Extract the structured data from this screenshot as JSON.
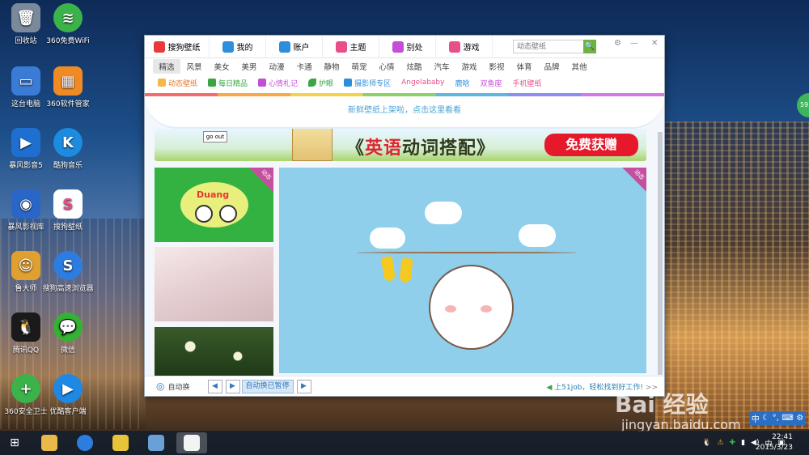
{
  "desktop": {
    "icons": [
      {
        "label": "回收站",
        "icon": "recycle-bin-icon",
        "color": "#7a8a9a",
        "glyph": "🗑"
      },
      {
        "label": "360免费WiFi",
        "icon": "wifi-icon",
        "color": "#3bb34a",
        "glyph": "≋"
      },
      {
        "label": "这台电脑",
        "icon": "computer-icon",
        "color": "#3a7bd5",
        "glyph": "▭"
      },
      {
        "label": "360软件管家",
        "icon": "app-store-icon",
        "color": "#f08a24",
        "glyph": "▦"
      },
      {
        "label": "暴风影音5",
        "icon": "media-player-icon",
        "color": "#1f6fd0",
        "glyph": "▶"
      },
      {
        "label": "酷狗音乐",
        "icon": "music-icon",
        "color": "#1d8be0",
        "glyph": "K"
      },
      {
        "label": "暴风影视库",
        "icon": "video-library-icon",
        "color": "#2a66c7",
        "glyph": "◉"
      },
      {
        "label": "搜狗壁纸",
        "icon": "wallpaper-app-icon",
        "color": "#ffffff",
        "glyph": "S"
      },
      {
        "label": "鲁大师",
        "icon": "ludashi-icon",
        "color": "#e0a030",
        "glyph": "☺"
      },
      {
        "label": "搜狗高速浏览器",
        "icon": "browser-icon",
        "color": "#2d7de0",
        "glyph": "S"
      },
      {
        "label": "腾讯QQ",
        "icon": "qq-icon",
        "color": "#1a1a1a",
        "glyph": "🐧"
      },
      {
        "label": "微信",
        "icon": "wechat-icon",
        "color": "#34b233",
        "glyph": "💬"
      },
      {
        "label": "360安全卫士",
        "icon": "security-guard-icon",
        "color": "#3bb34a",
        "glyph": "+"
      },
      {
        "label": "优酷客户端",
        "icon": "youku-icon",
        "color": "#1e88e5",
        "glyph": "▶"
      }
    ],
    "watermark": "Bai 经验",
    "watermark_url": "jingyan.baidu.com",
    "side_badge": "59"
  },
  "app": {
    "tabs": [
      {
        "label": "搜狗壁纸",
        "icon": "sogou-logo-icon",
        "color": "#e83a3a"
      },
      {
        "label": "我的",
        "icon": "monitor-icon",
        "color": "#2d8fdc"
      },
      {
        "label": "账户",
        "icon": "user-icon",
        "color": "#2d8fdc"
      },
      {
        "label": "主题",
        "icon": "theme-icon",
        "color": "#e84e8a"
      },
      {
        "label": "别处",
        "icon": "camera-icon",
        "color": "#c44fd6"
      },
      {
        "label": "游戏",
        "icon": "game-icon",
        "color": "#e84e8a"
      }
    ],
    "search_placeholder": "动态壁纸",
    "search_button": "🔍",
    "window_controls": {
      "settings": "⚙",
      "minimize": "—",
      "close": "✕"
    },
    "categories": [
      "精选",
      "风景",
      "美女",
      "美男",
      "动漫",
      "卡通",
      "静物",
      "萌宠",
      "心情",
      "炫酷",
      "汽车",
      "游戏",
      "影视",
      "体育",
      "品牌",
      "其他"
    ],
    "subnav": [
      {
        "label": "动态壁纸",
        "color": "#e8762a",
        "icon": "sparkle-icon"
      },
      {
        "label": "每日精品",
        "color": "#3aa544",
        "icon": "calendar-icon"
      },
      {
        "label": "心情札记",
        "color": "#c44fd6",
        "icon": "notes-icon"
      },
      {
        "label": "护眼",
        "color": "#3aa544",
        "icon": "leaf-icon"
      },
      {
        "label": "摄影师专区",
        "color": "#2d8fdc",
        "icon": "camera-icon"
      },
      {
        "label": "Angelababy",
        "color": "#e84e8a",
        "icon": ""
      },
      {
        "label": "鹿晗",
        "color": "#2d8fdc",
        "icon": ""
      },
      {
        "label": "双鱼座",
        "color": "#c44fd6",
        "icon": ""
      },
      {
        "label": "手机壁纸",
        "color": "#e84e8a",
        "icon": ""
      }
    ],
    "banner_top_text": "新鲜壁纸上架啦，点击这里看看",
    "banner": {
      "go_out": "go out",
      "title_red": "英语",
      "title_rest": "动词搭配",
      "open": "《",
      "close": "》",
      "cta": "免费获赠"
    },
    "dynamic_tag": "动态",
    "duang_text": "Duang",
    "footer": {
      "auto_label": "自动换",
      "auto_paused": "自动换已暂停",
      "prev": "◀",
      "play": "▶",
      "next": "▶",
      "ad_text": "上51job，轻松找到好工作!",
      "more": ">>"
    }
  },
  "taskbar": {
    "start": "⊞",
    "apps": [
      {
        "name": "file-explorer",
        "color": "#e8b949"
      },
      {
        "name": "sogou-browser",
        "color": "#2d7de0"
      },
      {
        "name": "store-app",
        "color": "#e7c43a"
      },
      {
        "name": "paint-app",
        "color": "#6aa0d8"
      },
      {
        "name": "sogou-wallpaper",
        "color": "#f3f3f3"
      }
    ],
    "tray_lang": "中",
    "time": "22:41",
    "date": "2015/3/23",
    "ime": [
      "中",
      "☾",
      "°,",
      "⌨",
      "⚙"
    ]
  }
}
